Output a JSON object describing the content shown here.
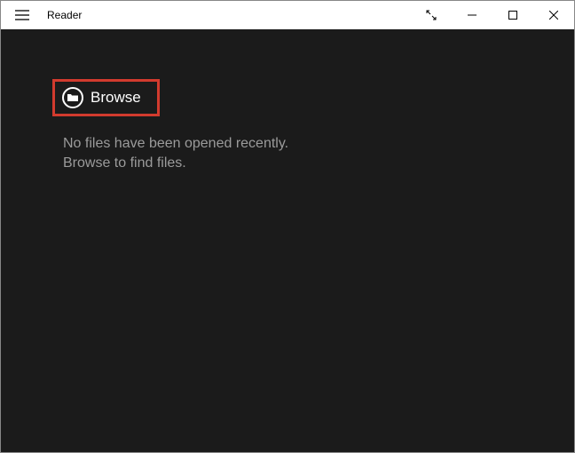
{
  "titlebar": {
    "app_title": "Reader"
  },
  "content": {
    "browse_label": "Browse",
    "empty_line1": "No files have been opened recently.",
    "empty_line2": "Browse to find files."
  },
  "colors": {
    "highlight": "#d23b2e",
    "background": "#1b1b1b"
  }
}
